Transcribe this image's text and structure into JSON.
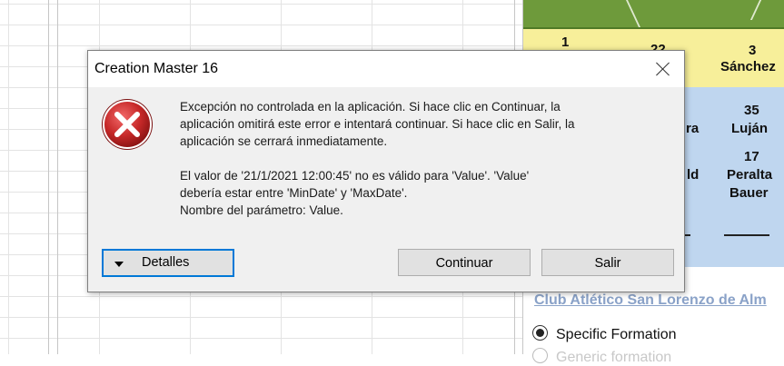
{
  "background": {
    "players": [
      {
        "number": "1",
        "name": ""
      },
      {
        "number": "22",
        "name": ""
      },
      {
        "number": "3",
        "name": "Sánchez"
      },
      {
        "number": "",
        "name": "ra"
      },
      {
        "number": "35",
        "name": "Luján"
      },
      {
        "number": "",
        "name": "ld"
      },
      {
        "number": "17",
        "name": "Peralta"
      },
      {
        "number": "",
        "name": "Bauer"
      }
    ],
    "club_link": "Club Atlético San Lorenzo de Alm",
    "formation_options": [
      {
        "label": "Specific Formation",
        "checked": true
      },
      {
        "label": "Generic formation",
        "checked": false
      }
    ]
  },
  "dialog": {
    "title": "Creation Master 16",
    "close_icon": "close-icon",
    "icon": "error-icon",
    "message_lines": [
      "Excepción no controlada en la aplicación. Si hace clic en Continuar, la",
      "aplicación omitirá este error e intentará continuar. Si hace clic en Salir, la",
      "aplicación se cerrará inmediatamente."
    ],
    "detail_lines": [
      "El valor de '21/1/2021 12:00:45' no es válido para 'Value'. 'Value'",
      "debería estar entre 'MinDate' y 'MaxDate'.",
      "Nombre del parámetro: Value."
    ],
    "details_button": "Detalles",
    "continue_button": "Continuar",
    "exit_button": "Salir"
  },
  "colors": {
    "pitch_green": "#6e9a3b",
    "zone_yellow": "#f7ef9a",
    "zone_blue": "#bfd6ef",
    "focus_blue": "#0078d7",
    "error_red": "#c62828"
  }
}
